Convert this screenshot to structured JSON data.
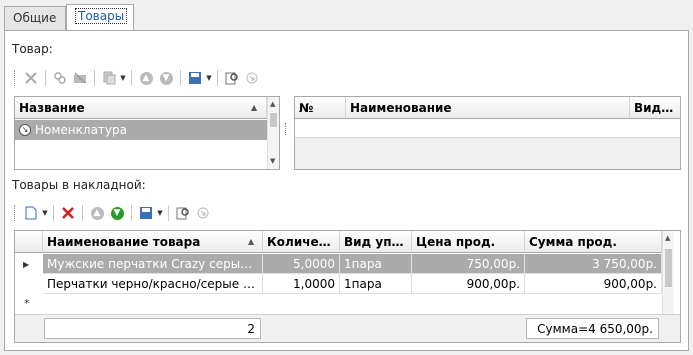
{
  "tabs": [
    {
      "label": "Общие"
    },
    {
      "label": "Товары"
    }
  ],
  "goods_section": {
    "label": "Товар:",
    "left_grid": {
      "header": "Название",
      "rows": [
        "Номенклатура"
      ]
    },
    "right_grid": {
      "headers": [
        "№",
        "Наименование",
        "Вид ..."
      ]
    }
  },
  "invoice_section": {
    "label": "Товары в накладной:",
    "headers": [
      "Наименование товара",
      "Количес...",
      "Вид упа...",
      "Цена прод.",
      "Сумма прод."
    ],
    "rows": [
      {
        "name": "Мужские перчатки Crazy серые с ...",
        "qty": "5,0000",
        "pack": "1пара",
        "price": "750,00р.",
        "sum": "3 750,00р.",
        "selected": true
      },
      {
        "name": "Перчатки черно/красно/серые Ext...",
        "qty": "1,0000",
        "pack": "1пара",
        "price": "900,00р.",
        "sum": "900,00р.",
        "selected": false
      }
    ],
    "footer": {
      "count": "2",
      "total": "Сумма=4 650,00р."
    }
  },
  "colors": {
    "accent": "#1c5fa8",
    "selected_row": "#ababab",
    "delete_red": "#d21f1f",
    "green": "#2a9a2a"
  }
}
